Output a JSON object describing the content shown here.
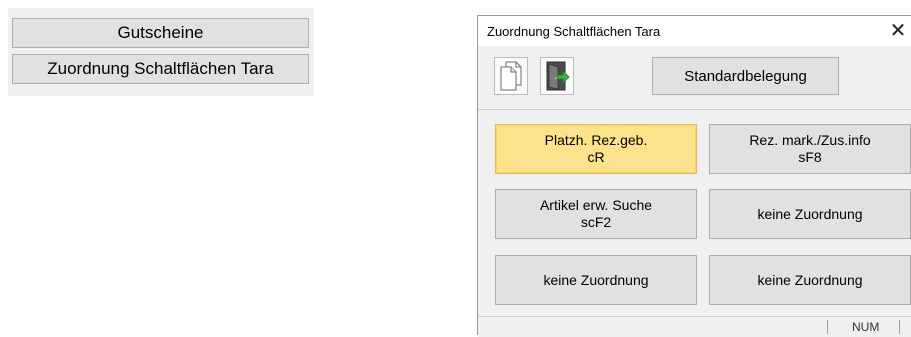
{
  "left_panel": {
    "buttons": [
      {
        "label": "Gutscheine"
      },
      {
        "label": "Zuordnung Schaltflächen Tara"
      }
    ]
  },
  "dialog": {
    "title": "Zuordnung Schaltflächen Tara",
    "close_glyph": "✕",
    "toolbar": {
      "copy_icon": "copy-document-icon",
      "exit_icon": "exit-door-icon",
      "default_button": "Standardbelegung"
    },
    "grid": [
      {
        "line1": "Platzh. Rez.geb.",
        "line2": "cR",
        "active": true
      },
      {
        "line1": "Rez. mark./Zus.info",
        "line2": "sF8",
        "active": false
      },
      {
        "line1": "Artikel erw. Suche",
        "line2": "scF2",
        "active": false
      },
      {
        "line1": "keine Zuordnung",
        "line2": "",
        "active": false
      },
      {
        "line1": "keine Zuordnung",
        "line2": "",
        "active": false
      },
      {
        "line1": "keine Zuordnung",
        "line2": "",
        "active": false
      }
    ],
    "status": {
      "num": "NUM"
    }
  },
  "colors": {
    "active_button": "#fce28a",
    "button_face": "#e1e1e1",
    "window_bg": "#f0f0f0"
  }
}
